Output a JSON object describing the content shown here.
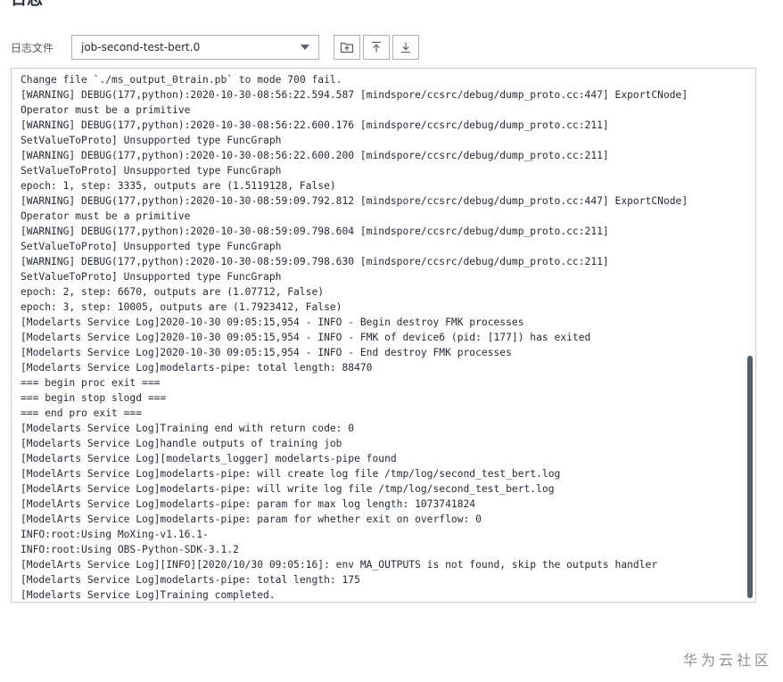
{
  "page": {
    "heading": "日志"
  },
  "toolbar": {
    "file_label": "日志文件",
    "selected_file": "job-second-test-bert.0",
    "icons": [
      "open-folder-icon",
      "upload-icon",
      "download-icon"
    ]
  },
  "log": {
    "lines": [
      "Change file `./ms_output_0train.pb` to mode 700 fail.",
      "[WARNING] DEBUG(177,python):2020-10-30-08:56:22.594.587 [mindspore/ccsrc/debug/dump_proto.cc:447] ExportCNode]",
      "Operator must be a primitive",
      "[WARNING] DEBUG(177,python):2020-10-30-08:56:22.600.176 [mindspore/ccsrc/debug/dump_proto.cc:211]",
      "SetValueToProto] Unsupported type FuncGraph",
      "[WARNING] DEBUG(177,python):2020-10-30-08:56:22.600.200 [mindspore/ccsrc/debug/dump_proto.cc:211]",
      "SetValueToProto] Unsupported type FuncGraph",
      "epoch: 1, step: 3335, outputs are (1.5119128, False)",
      "[WARNING] DEBUG(177,python):2020-10-30-08:59:09.792.812 [mindspore/ccsrc/debug/dump_proto.cc:447] ExportCNode]",
      "Operator must be a primitive",
      "[WARNING] DEBUG(177,python):2020-10-30-08:59:09.798.604 [mindspore/ccsrc/debug/dump_proto.cc:211]",
      "SetValueToProto] Unsupported type FuncGraph",
      "[WARNING] DEBUG(177,python):2020-10-30-08:59:09.798.630 [mindspore/ccsrc/debug/dump_proto.cc:211]",
      "SetValueToProto] Unsupported type FuncGraph",
      "epoch: 2, step: 6670, outputs are (1.07712, False)",
      "epoch: 3, step: 10005, outputs are (1.7923412, False)",
      "[Modelarts Service Log]2020-10-30 09:05:15,954 - INFO - Begin destroy FMK processes",
      "[Modelarts Service Log]2020-10-30 09:05:15,954 - INFO - FMK of device6 (pid: [177]) has exited",
      "[Modelarts Service Log]2020-10-30 09:05:15,954 - INFO - End destroy FMK processes",
      "[Modelarts Service Log]modelarts-pipe: total length: 88470",
      "=== begin proc exit ===",
      "=== begin stop slogd ===",
      "=== end pro exit ===",
      "[Modelarts Service Log]Training end with return code: 0",
      "[Modelarts Service Log]handle outputs of training job",
      "[Modelarts Service Log][modelarts_logger] modelarts-pipe found",
      "[ModelArts Service Log]modelarts-pipe: will create log file /tmp/log/second_test_bert.log",
      "[ModelArts Service Log]modelarts-pipe: will write log file /tmp/log/second_test_bert.log",
      "[ModelArts Service Log]modelarts-pipe: param for max log length: 1073741824",
      "[ModelArts Service Log]modelarts-pipe: param for whether exit on overflow: 0",
      "INFO:root:Using MoXing-v1.16.1-",
      "INFO:root:Using OBS-Python-SDK-3.1.2",
      "[ModelArts Service Log][INFO][2020/10/30 09:05:16]: env MA_OUTPUTS is not found, skip the outputs handler",
      "[Modelarts Service Log]modelarts-pipe: total length: 175",
      "[Modelarts Service Log]Training completed."
    ]
  },
  "watermark": "华为云社区"
}
